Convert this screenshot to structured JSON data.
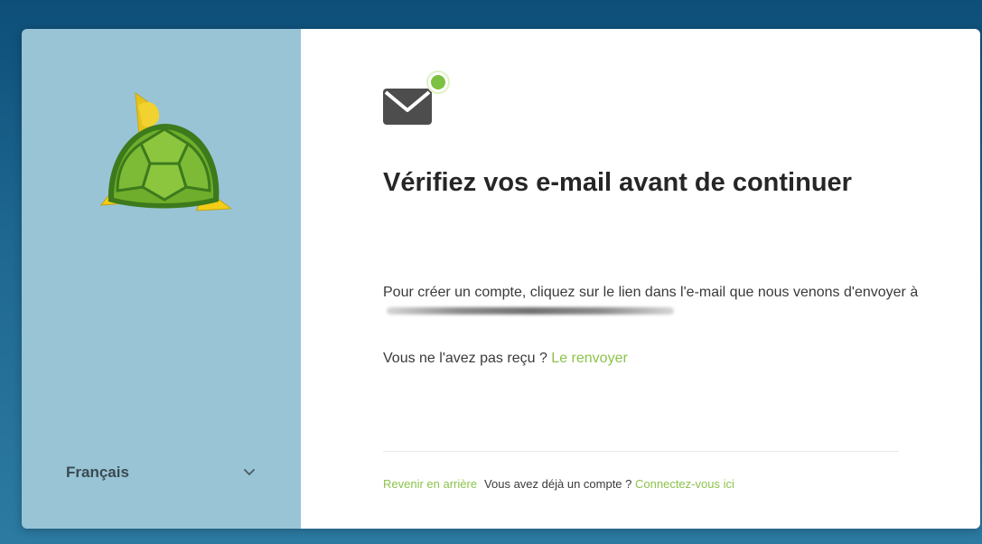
{
  "language": {
    "selected": "Français"
  },
  "verify": {
    "title": "Vérifiez vos e-mail avant de continuer",
    "message": "Pour créer un compte, cliquez sur le lien dans l'e-mail que nous venons d'envoyer à",
    "not_received": "Vous ne l'avez pas reçu ?",
    "resend_link": "Le renvoyer"
  },
  "footer": {
    "back_link": "Revenir en arrière",
    "have_account": "Vous avez déjà un compte ?",
    "login_link": "Connectez-vous ici"
  },
  "icons": {
    "logo": "turtle-logo",
    "language_toggle": "chevron-down-icon",
    "mail": "mail-icon",
    "notification": "green-dot-badge"
  },
  "colors": {
    "page_background": "#1d6690",
    "sidebar_background": "#98c4d6",
    "link": "#8bc34a",
    "text": "#262626"
  }
}
